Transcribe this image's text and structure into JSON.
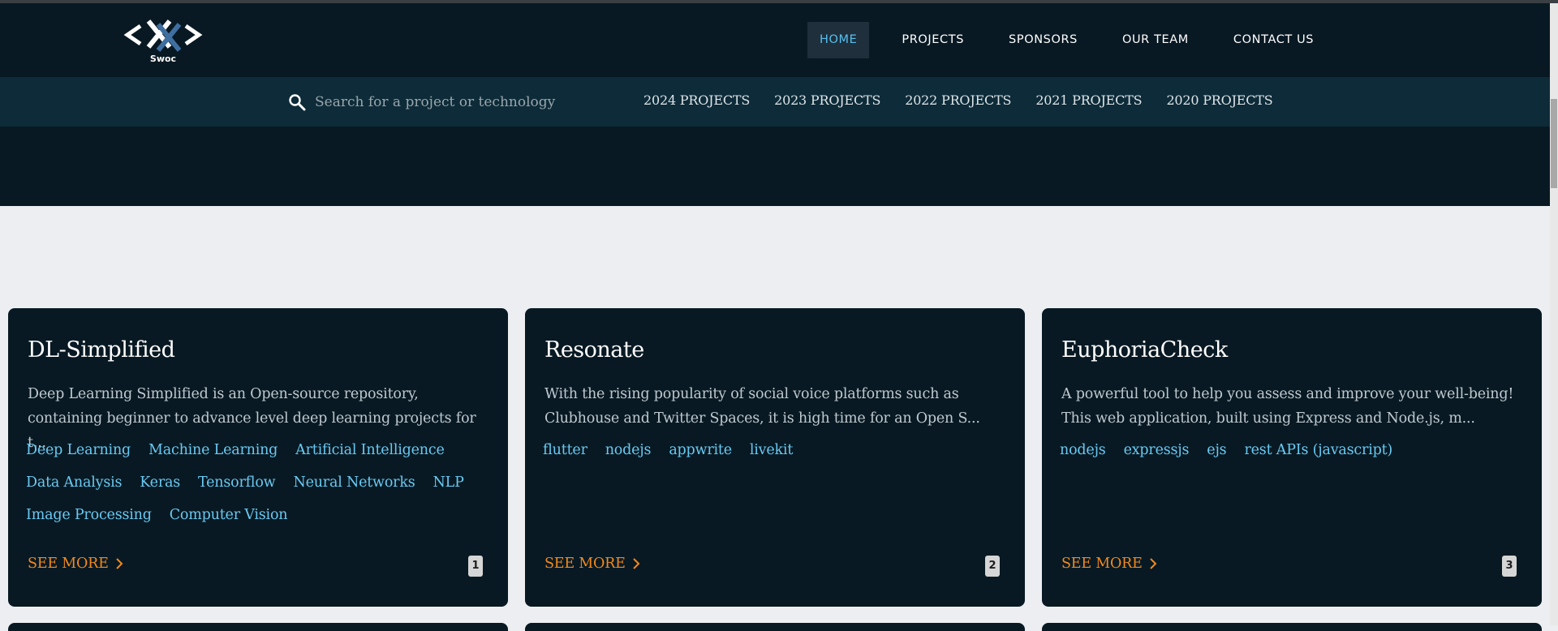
{
  "brand": {
    "logo_caption": "Swoc"
  },
  "main_nav": [
    {
      "label": "HOME",
      "active": true
    },
    {
      "label": "PROJECTS",
      "active": false
    },
    {
      "label": "SPONSORS",
      "active": false
    },
    {
      "label": "OUR TEAM",
      "active": false
    },
    {
      "label": "CONTACT US",
      "active": false
    }
  ],
  "search": {
    "placeholder": "Search for a project or technology",
    "value": ""
  },
  "year_links": [
    "2024 PROJECTS",
    "2023 PROJECTS",
    "2022 PROJECTS",
    "2021 PROJECTS",
    "2020 PROJECTS"
  ],
  "cards": [
    {
      "title": "DL-Simplified",
      "description": "Deep Learning Simplified is an Open-source repository, containing beginner to advance level deep learning projects for t...",
      "tags": [
        "Deep Learning",
        "Machine Learning",
        "Artificial Intelligence",
        "Data Analysis",
        "Keras",
        "Tensorflow",
        "Neural Networks",
        "NLP",
        "Image Processing",
        "Computer Vision"
      ],
      "see_more": "SEE MORE",
      "number": "1"
    },
    {
      "title": "Resonate",
      "description": "With the rising popularity of social voice platforms such as Clubhouse and Twitter Spaces, it is high time for an Open S...",
      "tags": [
        "flutter",
        "nodejs",
        "appwrite",
        "livekit"
      ],
      "see_more": "SEE MORE",
      "number": "2"
    },
    {
      "title": "EuphoriaCheck",
      "description": "A powerful tool to help you assess and improve your well-being! This web application, built using Express and Node.js, m...",
      "tags": [
        "nodejs",
        "expressjs",
        "ejs",
        "rest APIs (javascript)"
      ],
      "see_more": "SEE MORE",
      "number": "3"
    }
  ],
  "colors": {
    "header_bg": "#081923",
    "subbar_bg": "#0d2b38",
    "page_bg": "#eceef1",
    "card_bg": "#081923",
    "accent_blue": "#57c0ef",
    "tag_blue": "#69c9f2",
    "see_more_orange": "#f28a1e"
  }
}
